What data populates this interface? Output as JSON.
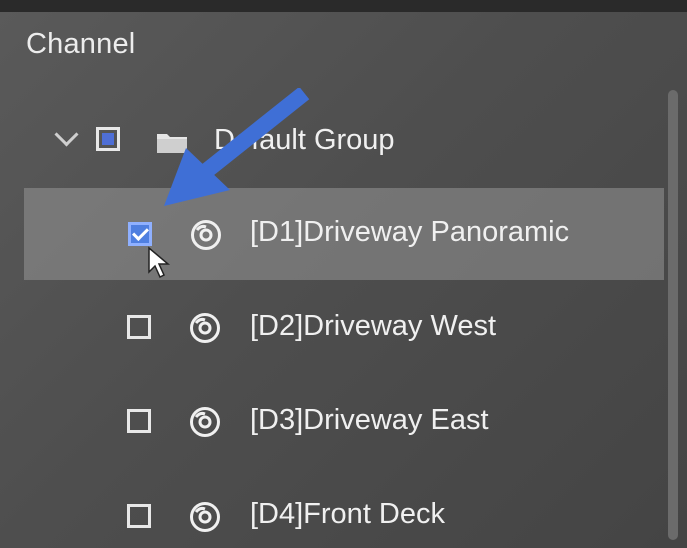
{
  "panel": {
    "title": "Channel"
  },
  "group": {
    "label": "Default Group",
    "expanded": true,
    "check_state": "partial"
  },
  "channels": [
    {
      "label": "[D1]Driveway Panoramic",
      "checked": true,
      "selected": true
    },
    {
      "label": "[D2]Driveway West",
      "checked": false,
      "selected": false
    },
    {
      "label": "[D3]Driveway East",
      "checked": false,
      "selected": false
    },
    {
      "label": "[D4]Front Deck",
      "checked": false,
      "selected": false
    }
  ],
  "colors": {
    "panel_bg": "#555555",
    "selection_bg": "#8a8a8a",
    "checkbox_accent": "#4f7fe0",
    "annotation_arrow": "#3f6fd6"
  },
  "icons": {
    "group_expand": "chevron-down-icon",
    "group": "folder-icon",
    "channel": "camera-icon",
    "pointer": "cursor-icon"
  }
}
